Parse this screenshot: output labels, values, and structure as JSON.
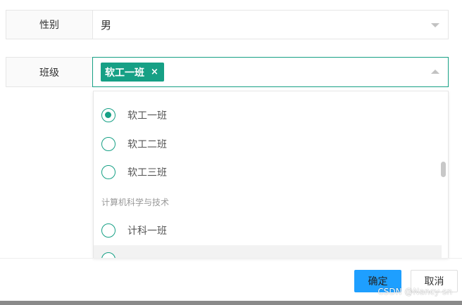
{
  "form": {
    "gender": {
      "label": "性别",
      "value": "男"
    },
    "class": {
      "label": "班级",
      "selected_tag": "软工一班",
      "tag_close": "×"
    }
  },
  "dropdown": {
    "options_top": [
      {
        "label": "软工一班",
        "checked": true
      },
      {
        "label": "软工二班",
        "checked": false
      },
      {
        "label": "软工三班",
        "checked": false
      }
    ],
    "group_title": "计算机科学与技术",
    "options_bottom": [
      {
        "label": "计科一班",
        "checked": false
      }
    ]
  },
  "footer": {
    "ok_label": "确定",
    "cancel_label": "取消"
  },
  "watermark": "CSDN @Nancy-sn",
  "colors": {
    "accent": "#16a085",
    "primary_button": "#1e9fff"
  },
  "icons": [
    "chevron-down-icon",
    "chevron-up-icon",
    "close-icon",
    "radio-icon"
  ]
}
